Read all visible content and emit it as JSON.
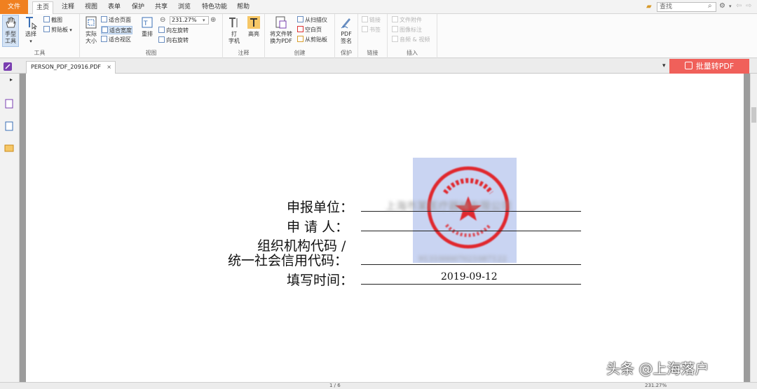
{
  "menu": {
    "tabs": [
      "文件",
      "主页",
      "注释",
      "视图",
      "表单",
      "保护",
      "共享",
      "浏览",
      "特色功能",
      "帮助"
    ],
    "search_placeholder": "查找"
  },
  "ribbon": {
    "tools_group": {
      "label": "工具",
      "hand_tool": "手型\n工具",
      "select_tool": "选择",
      "snapshot": "截图",
      "clipboard": "剪贴板"
    },
    "view_group": {
      "label": "视图",
      "actual_size": "实际\n大小",
      "fit_page": "适合页面",
      "fit_width": "适合宽度",
      "fit_visible": "适合视区",
      "reflow": "重排",
      "zoom_value": "231.27%",
      "rotate_left": "向左旋转",
      "rotate_right": "向右旋转"
    },
    "comment_group": {
      "label": "注释",
      "typewriter": "打\n字机",
      "highlight": "高亮"
    },
    "create_group": {
      "label": "创建",
      "convert_to_pdf": "将文件转\n换为PDF",
      "from_scanner": "从扫描仪",
      "blank_page": "空白页",
      "from_clipboard": "从剪贴板"
    },
    "protect_group": {
      "label": "保护",
      "pdf_sign": "PDF\n签名"
    },
    "links_group": {
      "label": "链接",
      "link": "链接",
      "bookmark": "书签"
    },
    "insert_group": {
      "label": "插入",
      "file_attachment": "文件附件",
      "image_annotation": "图像标注",
      "audio_video": "音频 & 视频"
    }
  },
  "document_tab": {
    "filename": "PERSON_PDF_20916.PDF",
    "close": "×",
    "batch_convert": "批量转PDF"
  },
  "document": {
    "fields": [
      {
        "label": "申报单位：",
        "value": "上海市某医疗器械有限公司"
      },
      {
        "label": "申  请  人：",
        "value": ""
      },
      {
        "label_line1": "组织机构代码 /",
        "label_line2": "统一社会信用代码：",
        "value": "913100007021087122"
      },
      {
        "label": "填写时间：",
        "value": "2019-09-12"
      }
    ],
    "stamp_color": "#e0282e"
  },
  "statusbar": {
    "page_indicator": "1 / 6",
    "zoom": "231.27%"
  },
  "watermark": "头条 @上海落户",
  "colors": {
    "file_tab": "#f08020",
    "batch_button": "#f0605a",
    "stamp_bg": "#c9d4f2"
  }
}
